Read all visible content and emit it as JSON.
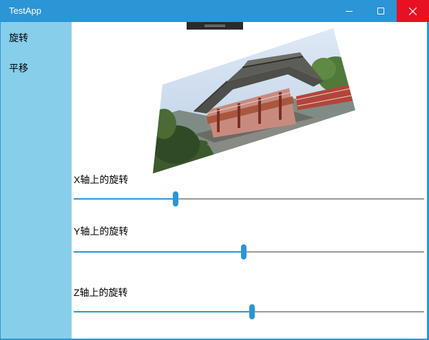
{
  "window": {
    "title": "TestApp"
  },
  "sidebar": {
    "items": [
      {
        "label": "旋转"
      },
      {
        "label": "平移"
      }
    ]
  },
  "sliders": [
    {
      "label": "X轴上的旋转",
      "value_fraction": 0.29
    },
    {
      "label": "Y轴上的旋转",
      "value_fraction": 0.485
    },
    {
      "label": "Z轴上的旋转",
      "value_fraction": 0.508
    }
  ],
  "colors": {
    "accent": "#2b95d6",
    "sidebar": "#87ceeb",
    "close": "#e81123",
    "track": "#999999"
  },
  "icons": [
    "minimize-icon",
    "maximize-icon",
    "close-icon"
  ]
}
